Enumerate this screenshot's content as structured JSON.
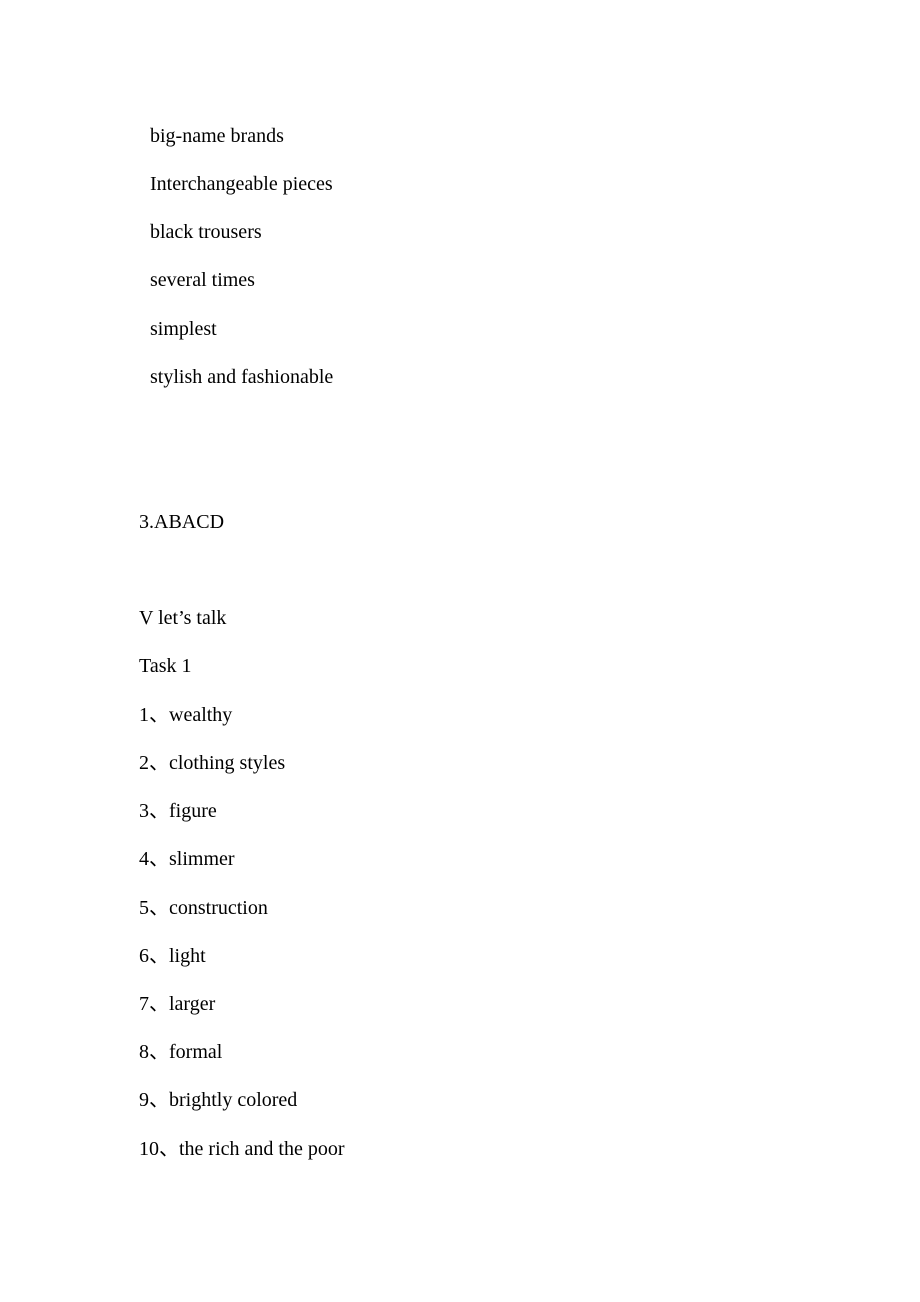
{
  "section_list": {
    "items": [
      "big-name brands",
      "Interchangeable pieces",
      "black trousers",
      "several times",
      "simplest",
      "stylish and fashionable"
    ]
  },
  "answer_3": "3.ABACD",
  "section_v": {
    "heading": "V let’s talk",
    "task": "Task 1",
    "answers": [
      "1、wealthy",
      "2、clothing styles",
      "3、figure",
      "4、slimmer",
      "5、construction",
      "6、light",
      "7、larger",
      "8、formal",
      "9、brightly colored",
      "10、the rich and the poor"
    ]
  }
}
